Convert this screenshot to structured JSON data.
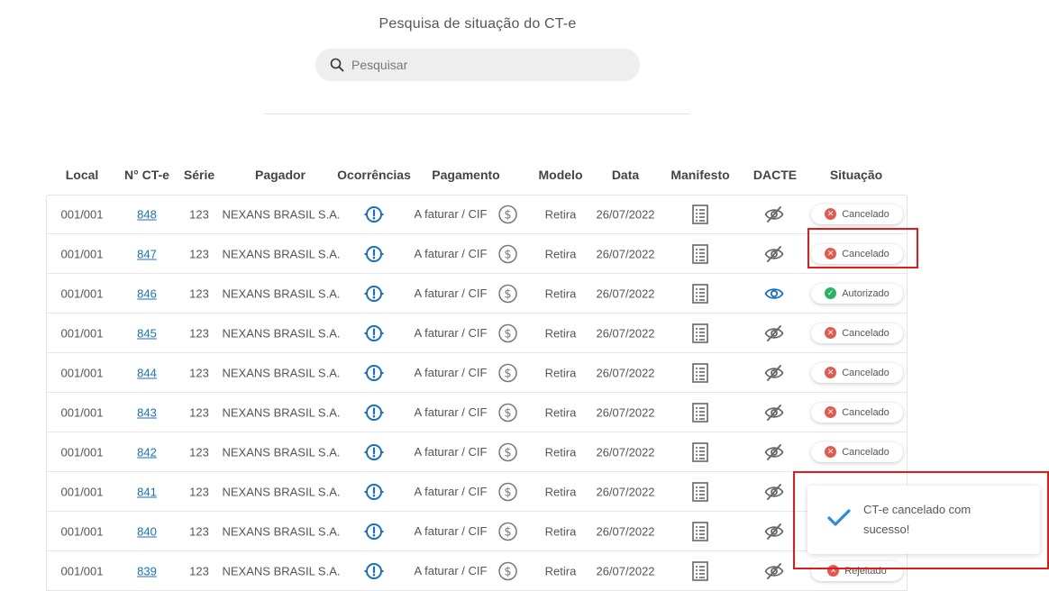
{
  "header": {
    "title": "Pesquisa de situação do CT-e",
    "search_placeholder": "Pesquisar"
  },
  "table": {
    "columns": {
      "local": "Local",
      "numero": "N° CT-e",
      "serie": "Série",
      "pagador": "Pagador",
      "ocorrencias": "Ocorrências",
      "pagamento": "Pagamento",
      "modelo": "Modelo",
      "data": "Data",
      "manifesto": "Manifesto",
      "dacte": "DACTE",
      "situacao": "Situação"
    },
    "rows": [
      {
        "local": "001/001",
        "numero": "848",
        "serie": "123",
        "pagador": "NEXANS BRASIL S.A.",
        "pagamento": "A faturar / CIF",
        "modelo": "Retira",
        "data": "26/07/2022",
        "dacte": "hidden",
        "situacao": "Cancelado",
        "status": "cancelled"
      },
      {
        "local": "001/001",
        "numero": "847",
        "serie": "123",
        "pagador": "NEXANS BRASIL S.A.",
        "pagamento": "A faturar / CIF",
        "modelo": "Retira",
        "data": "26/07/2022",
        "dacte": "hidden",
        "situacao": "Cancelado",
        "status": "cancelled"
      },
      {
        "local": "001/001",
        "numero": "846",
        "serie": "123",
        "pagador": "NEXANS BRASIL S.A.",
        "pagamento": "A faturar / CIF",
        "modelo": "Retira",
        "data": "26/07/2022",
        "dacte": "visible",
        "situacao": "Autorizado",
        "status": "authorized"
      },
      {
        "local": "001/001",
        "numero": "845",
        "serie": "123",
        "pagador": "NEXANS BRASIL S.A.",
        "pagamento": "A faturar / CIF",
        "modelo": "Retira",
        "data": "26/07/2022",
        "dacte": "hidden",
        "situacao": "Cancelado",
        "status": "cancelled"
      },
      {
        "local": "001/001",
        "numero": "844",
        "serie": "123",
        "pagador": "NEXANS BRASIL S.A.",
        "pagamento": "A faturar / CIF",
        "modelo": "Retira",
        "data": "26/07/2022",
        "dacte": "hidden",
        "situacao": "Cancelado",
        "status": "cancelled"
      },
      {
        "local": "001/001",
        "numero": "843",
        "serie": "123",
        "pagador": "NEXANS BRASIL S.A.",
        "pagamento": "A faturar / CIF",
        "modelo": "Retira",
        "data": "26/07/2022",
        "dacte": "hidden",
        "situacao": "Cancelado",
        "status": "cancelled"
      },
      {
        "local": "001/001",
        "numero": "842",
        "serie": "123",
        "pagador": "NEXANS BRASIL S.A.",
        "pagamento": "A faturar / CIF",
        "modelo": "Retira",
        "data": "26/07/2022",
        "dacte": "hidden",
        "situacao": "Cancelado",
        "status": "cancelled"
      },
      {
        "local": "001/001",
        "numero": "841",
        "serie": "123",
        "pagador": "NEXANS BRASIL S.A.",
        "pagamento": "A faturar / CIF",
        "modelo": "Retira",
        "data": "26/07/2022",
        "dacte": "hidden",
        "situacao": "",
        "status": "none"
      },
      {
        "local": "001/001",
        "numero": "840",
        "serie": "123",
        "pagador": "NEXANS BRASIL S.A.",
        "pagamento": "A faturar / CIF",
        "modelo": "Retira",
        "data": "26/07/2022",
        "dacte": "hidden",
        "situacao": "",
        "status": "none"
      },
      {
        "local": "001/001",
        "numero": "839",
        "serie": "123",
        "pagador": "NEXANS BRASIL S.A.",
        "pagamento": "A faturar / CIF",
        "modelo": "Retira",
        "data": "26/07/2022",
        "dacte": "hidden",
        "situacao": "Rejeitado",
        "status": "rejected"
      }
    ]
  },
  "toast": {
    "message": "CT-e cancelado com sucesso!"
  },
  "colors": {
    "accent": "#1a6fc4",
    "cancelled": "#e45a4f",
    "authorized": "#28b463",
    "highlight": "#e01b1b"
  },
  "icons": {
    "search": "search-icon",
    "ocorrencias": "alert-circle-icon",
    "pagamento": "dollar-circle-icon",
    "manifesto": "document-list-icon",
    "dacte_hidden": "eye-off-icon",
    "dacte_visible": "eye-icon",
    "toast": "check-icon"
  }
}
